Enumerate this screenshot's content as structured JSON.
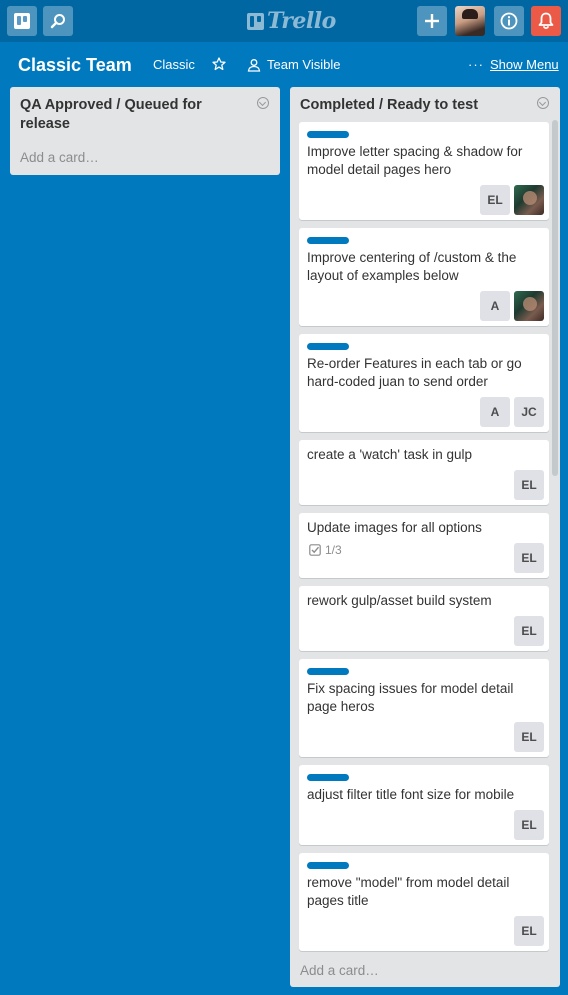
{
  "app": {
    "name": "Trello"
  },
  "topbar": {
    "icons": [
      "boards-icon",
      "search-icon",
      "add-icon",
      "avatar",
      "info-icon",
      "notification-bell-icon"
    ],
    "alert_color": "#eb5a46",
    "bar_color": "#0067a3"
  },
  "board": {
    "title": "Classic Team",
    "team": "Classic",
    "visibility": "Team Visible",
    "show_menu": "Show Menu",
    "background": "#0079bf"
  },
  "lists": [
    {
      "title": "QA Approved / Queued for release",
      "add_card": "Add a card…",
      "cards": []
    },
    {
      "title": "Completed / Ready to test",
      "add_card": "Add a card…",
      "cards": [
        {
          "label_color": "#0079bf",
          "title": "Improve letter spacing & shadow for model detail pages hero",
          "members": [
            "EL",
            "photo"
          ]
        },
        {
          "label_color": "#0079bf",
          "title": "Improve centering of /custom & the layout of examples below",
          "members": [
            "A",
            "photo"
          ]
        },
        {
          "label_color": "#0079bf",
          "title": "Re-order Features in each tab or go hard-coded juan to send order",
          "members": [
            "A",
            "JC"
          ]
        },
        {
          "title": "create a 'watch' task in gulp",
          "members": [
            "EL"
          ]
        },
        {
          "title": "Update images for all options",
          "checklist": "1/3",
          "members": [
            "EL"
          ]
        },
        {
          "title": "rework gulp/asset build system",
          "members": [
            "EL"
          ]
        },
        {
          "label_color": "#0079bf",
          "title": "Fix spacing issues for model detail page heros",
          "members": [
            "EL"
          ]
        },
        {
          "label_color": "#0079bf",
          "title": "adjust filter title font size for mobile",
          "members": [
            "EL"
          ]
        },
        {
          "label_color": "#0079bf",
          "title": "remove \"model\" from model detail pages title",
          "members": [
            "EL"
          ]
        }
      ]
    }
  ]
}
